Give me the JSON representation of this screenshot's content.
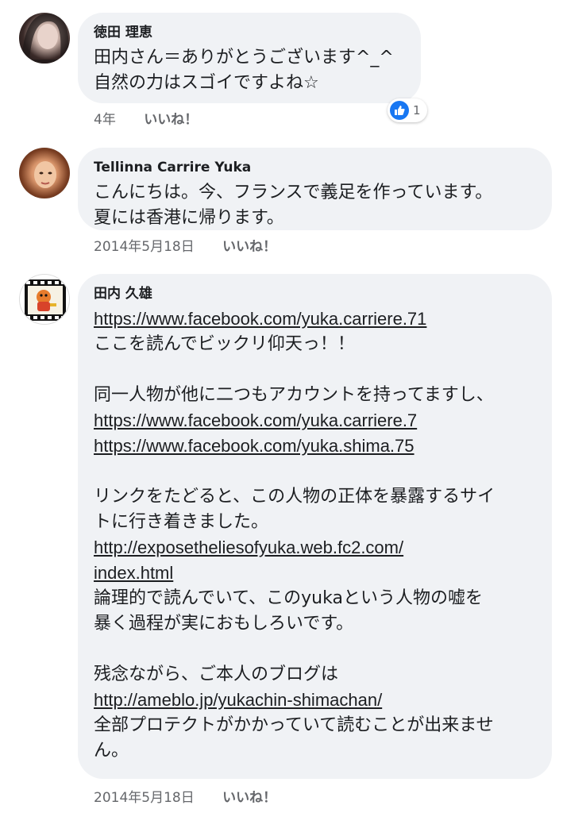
{
  "comments": [
    {
      "author": "徳田 理恵",
      "lines": [
        "田内さん＝ありがとうございます^_^",
        "自然の力はスゴイですよね☆"
      ],
      "time": "4年",
      "like": "いいね！",
      "reaction_count": "1"
    },
    {
      "author": "Tellinna Carrire Yuka",
      "lines": [
        "こんにちは。今、フランスで義足を作っています。",
        "夏には香港に帰ります。"
      ],
      "time": "2014年5月18日",
      "like": "いいね！"
    },
    {
      "author": "田内 久雄",
      "link1": "https://www.facebook.com/yuka.carriere.71",
      "text1": "ここを読んでビックリ仰天っ！！",
      "text2": "同一人物が他に二つもアカウントを持ってますし、",
      "link2": "https://www.facebook.com/yuka.carriere.7",
      "link3": "https://www.facebook.com/yuka.shima.75",
      "text3a": "リンクをたどると、この人物の正体を暴露するサイ",
      "text3b": "トに行き着きました。",
      "link4a": "http://exposetheliesofyuka.web.fc2.com/",
      "link4b": "index.html",
      "text4a": "論理的で読んでいて、このyukaという人物の嘘を",
      "text4b": "暴く過程が実におもしろいです。",
      "text5": "残念ながら、ご本人のブログは",
      "link5": "http://ameblo.jp/yukachin-shimachan/",
      "text6a": "全部プロテクトがかかっていて読むことが出来ませ",
      "text6b": "ん。",
      "time": "2014年5月18日",
      "like": "いいね！"
    }
  ],
  "colors": {
    "bubble": "#f0f2f5",
    "like_blue": "#1877f2",
    "meta": "#65676b"
  },
  "icons": {
    "reaction": "thumbs-up-icon"
  }
}
